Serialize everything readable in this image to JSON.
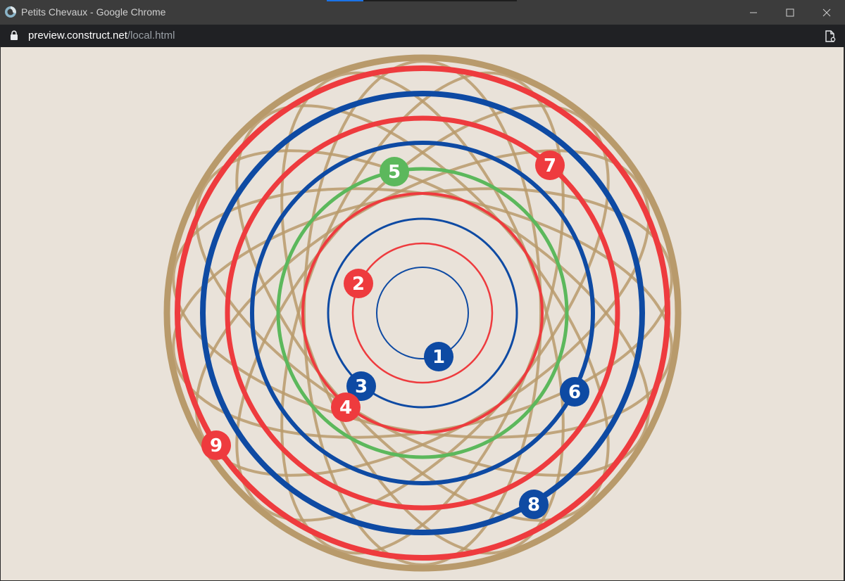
{
  "window": {
    "title": "Petits Chevaux - Google Chrome"
  },
  "address_bar": {
    "host": "preview.construct.net",
    "path": "/local.html"
  },
  "game": {
    "background_color": "#e9e2d9",
    "colors": {
      "red": "#ee3b3e",
      "blue": "#0e4aa3",
      "green": "#5cb85c",
      "tan": "#b89a6b"
    },
    "tokens": [
      {
        "label": "1",
        "color": "blue"
      },
      {
        "label": "2",
        "color": "red"
      },
      {
        "label": "3",
        "color": "blue"
      },
      {
        "label": "4",
        "color": "red"
      },
      {
        "label": "5",
        "color": "green"
      },
      {
        "label": "6",
        "color": "blue"
      },
      {
        "label": "7",
        "color": "red"
      },
      {
        "label": "8",
        "color": "blue"
      },
      {
        "label": "9",
        "color": "red"
      }
    ]
  }
}
